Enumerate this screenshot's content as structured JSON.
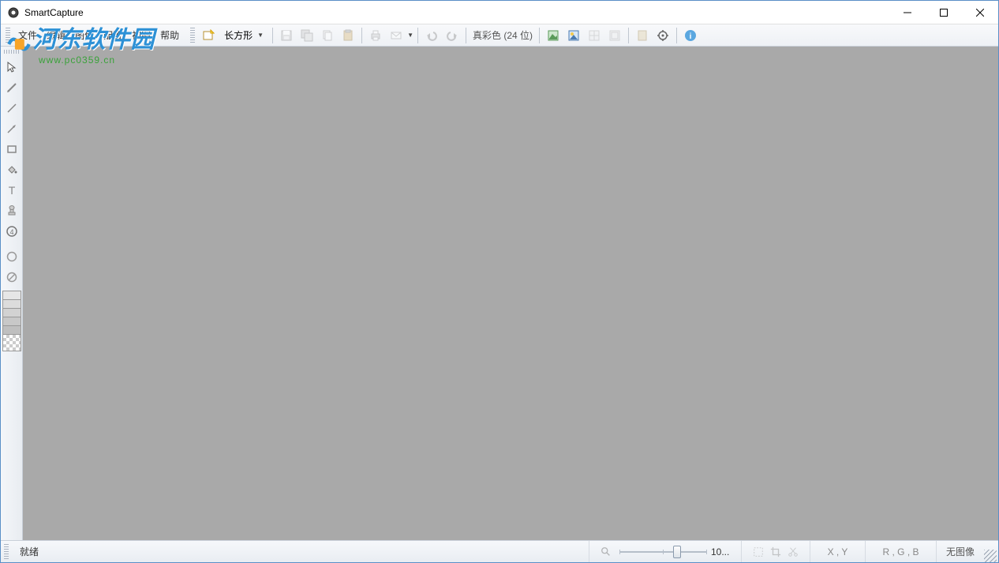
{
  "app": {
    "title": "SmartCapture"
  },
  "menu": {
    "file": "文件",
    "edit": "编辑",
    "image": "图像",
    "config": "配置",
    "view": "视图",
    "help": "帮助"
  },
  "toolbar": {
    "capture_mode": "长方形",
    "color_depth": "真彩色 (24 位)"
  },
  "watermark": {
    "main": "河东软件园",
    "sub": "www.pc0359.cn"
  },
  "statusbar": {
    "ready": "就绪",
    "zoom": "10...",
    "xy": "X , Y",
    "rgb": "R , G , B",
    "noimage": "无图像"
  },
  "tool_palette_swatches": [
    "#e6e6e6",
    "#d9d9d9",
    "#cfcfcf",
    "#c4c4c4",
    "#bcbcbc"
  ],
  "checker": true
}
